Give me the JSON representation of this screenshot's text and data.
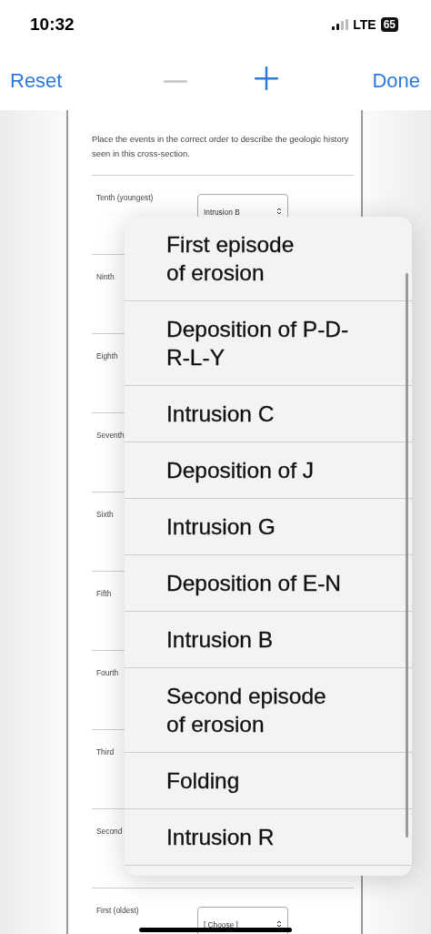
{
  "status_bar": {
    "time": "10:32",
    "network": "LTE",
    "battery": "65"
  },
  "toolbar": {
    "reset": "Reset",
    "zoom_out": {
      "disabled": true
    },
    "zoom_in": {
      "disabled": false
    },
    "done": "Done"
  },
  "document": {
    "instructions": "Place the events in the correct order to describe the geologic history seen in this cross-section.",
    "rows": [
      {
        "label": "Tenth (youngest)",
        "value": "Intrusion B"
      },
      {
        "label": "Ninth"
      },
      {
        "label": "Eighth"
      },
      {
        "label": "Seventh"
      },
      {
        "label": "Sixth"
      },
      {
        "label": "Fifth"
      },
      {
        "label": "Fourth"
      },
      {
        "label": "Third"
      },
      {
        "label": "Second"
      },
      {
        "label": "First (oldest)",
        "value": "[ Choose ]"
      }
    ]
  },
  "menu": {
    "items": [
      {
        "label": "First episode\nof erosion"
      },
      {
        "label": "Deposition of P-D-\nR-L-Y"
      },
      {
        "label": "Intrusion C"
      },
      {
        "label": "Deposition of J"
      },
      {
        "label": "Intrusion G"
      },
      {
        "label": "Deposition of E-N"
      },
      {
        "label": "Intrusion B"
      },
      {
        "label": "Second episode\nof erosion"
      },
      {
        "label": "Folding"
      },
      {
        "label": "Intrusion R"
      }
    ]
  }
}
